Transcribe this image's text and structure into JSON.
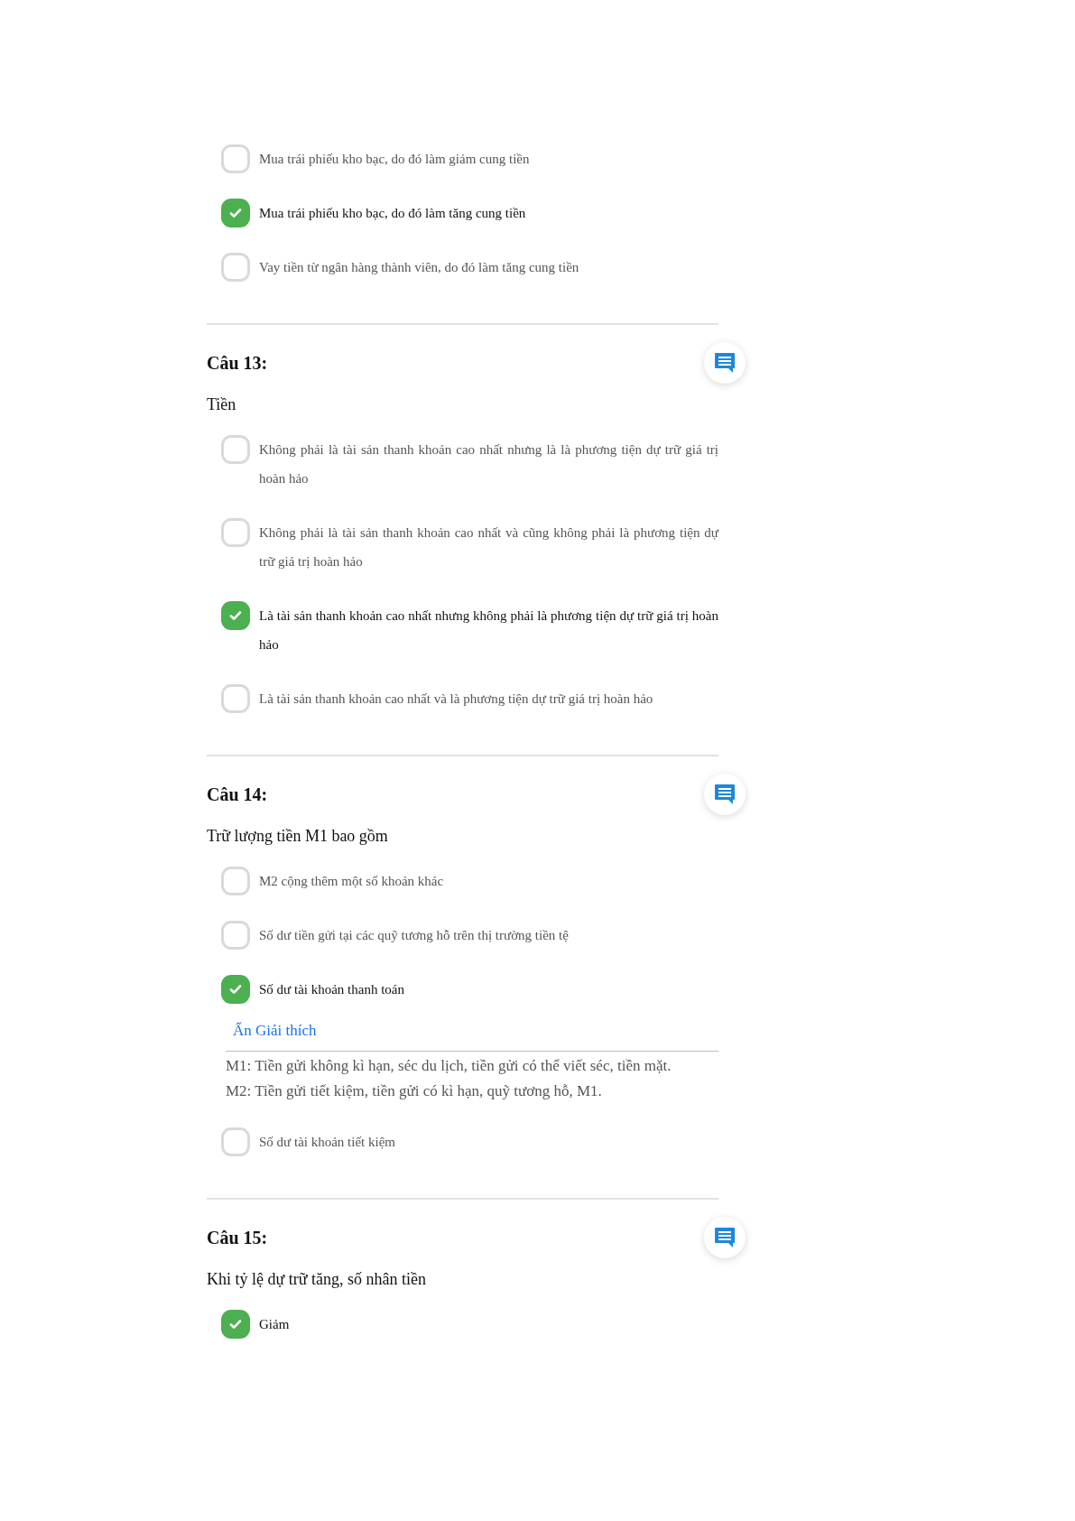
{
  "questions": [
    {
      "options": [
        {
          "text": "Mua trái phiếu kho bạc, do đó làm giảm cung tiền",
          "checked": false
        },
        {
          "text": "Mua trái phiếu kho bạc, do đó làm tăng cung tiền",
          "checked": true
        },
        {
          "text": "Vay tiền từ ngân hàng thành viên, do đó làm tăng cung tiền",
          "checked": false
        }
      ]
    },
    {
      "title": "Câu 13:",
      "prompt": "Tiền",
      "options": [
        {
          "text": "Không phải là tài sản thanh khoản cao nhất nhưng là là phương tiện dự trữ giá trị hoàn hảo",
          "checked": false
        },
        {
          "text": "Không phải là tài sản thanh khoản cao nhất và cũng không phải là phương tiện dự trữ giá trị hoàn hảo",
          "checked": false
        },
        {
          "text": "Là tài sản thanh khoản cao nhất nhưng không phải là phương tiện dự trữ giá trị hoàn hảo",
          "checked": true
        },
        {
          "text": "Là tài sản thanh khoản cao nhất và là phương tiện dự trữ giá trị hoàn hảo",
          "checked": false
        }
      ]
    },
    {
      "title": "Câu 14:",
      "prompt": "Trữ lượng tiền M1 bao gồm",
      "options": [
        {
          "text": "M2 cộng thêm một số khoản khác",
          "checked": false
        },
        {
          "text": "Số dư tiền gửi tại các quỹ tương hỗ trên thị trường tiền tệ",
          "checked": false
        },
        {
          "text": "Số dư tài khoản thanh toán",
          "checked": true,
          "explanation": {
            "toggle": "Ẩn Giải thích",
            "paragraphs": [
              "M1: Tiền gửi không kì hạn, séc du lịch, tiền gửi có thể viết séc, tiền mặt.",
              "M2: Tiền gửi tiết kiệm, tiền gửi có kì hạn, quỹ tương hỗ, M1."
            ]
          }
        },
        {
          "text": "Số dư tài khoản tiết kiệm",
          "checked": false
        }
      ]
    },
    {
      "title": "Câu 15:",
      "prompt": "Khi tỷ lệ dự trữ tăng, số nhân tiền",
      "options": [
        {
          "text": "Giảm",
          "checked": true
        }
      ]
    }
  ]
}
